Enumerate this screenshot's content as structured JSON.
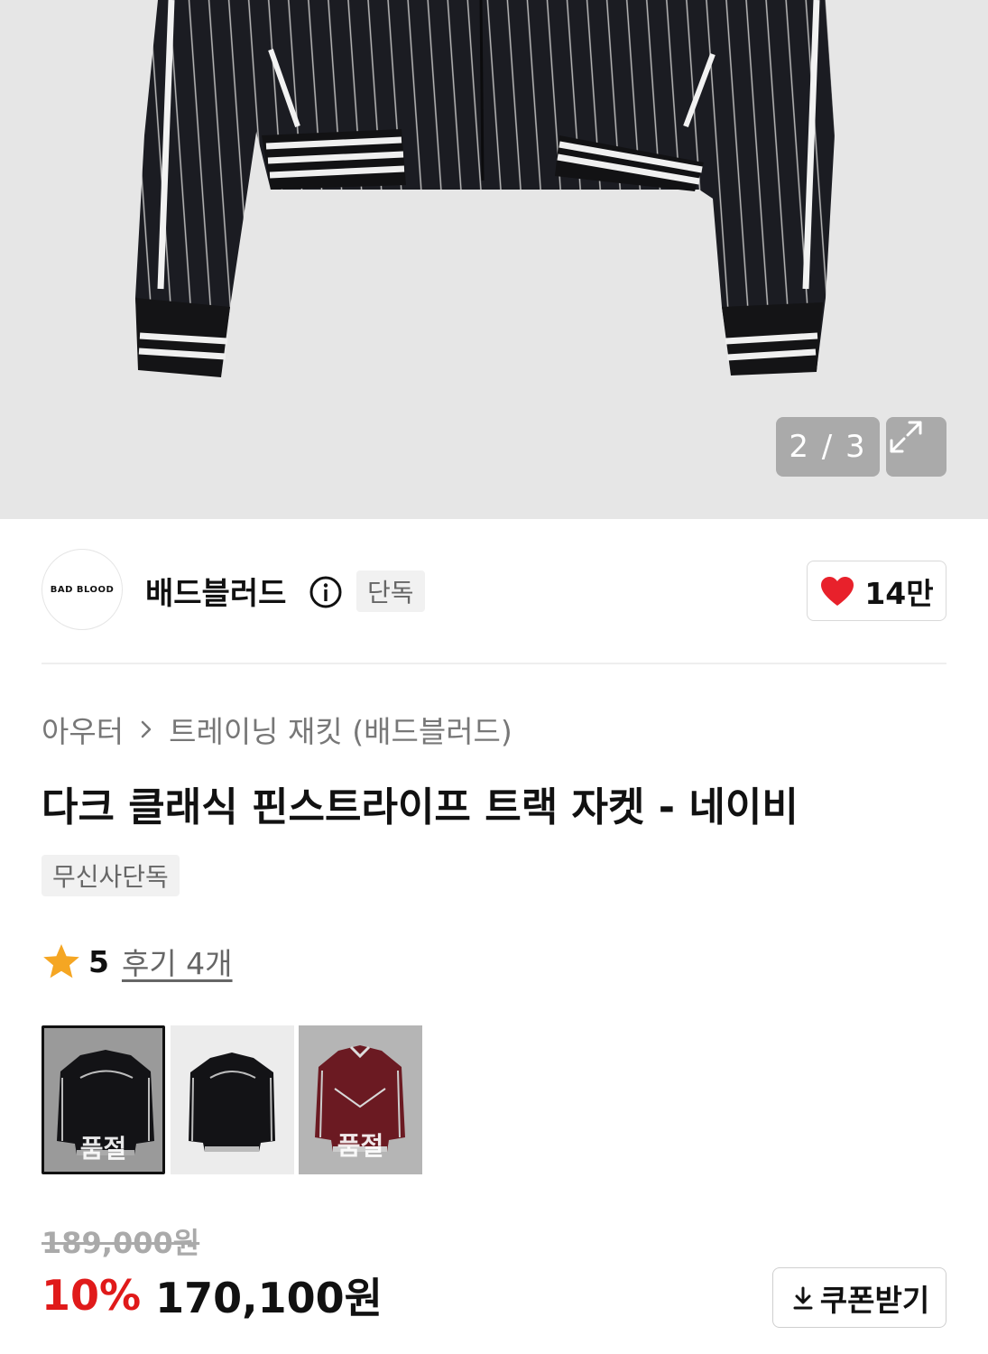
{
  "gallery": {
    "counter": "2 / 3",
    "expand_icon": "expand-icon"
  },
  "brand": {
    "logo_text": "BAD BLOOD",
    "name": "배드블러드",
    "info_icon": "info-icon",
    "tag": "단독",
    "like_icon": "heart-icon",
    "like_count": "14만",
    "colors": {
      "heart": "#e8212b"
    }
  },
  "breadcrumb": {
    "category": "아우터",
    "subcategory": "트레이닝 재킷 (배드블러드)"
  },
  "product": {
    "title": "다크 클래식 핀스트라이프 트랙 자켓 - 네이비",
    "badge": "무신사단독"
  },
  "rating": {
    "star_icon": "star-icon",
    "score": "5",
    "reviews": "후기 4개"
  },
  "thumbnails": [
    {
      "label": "품절",
      "selected": true
    },
    {
      "label": "",
      "selected": false
    },
    {
      "label": "품절",
      "selected": false
    }
  ],
  "price": {
    "original": "189,000원",
    "discount": "10%",
    "sale": "170,100원",
    "colors": {
      "discount": "#e01a1a"
    }
  },
  "coupon": {
    "icon": "download-icon",
    "label": "쿠폰받기"
  }
}
